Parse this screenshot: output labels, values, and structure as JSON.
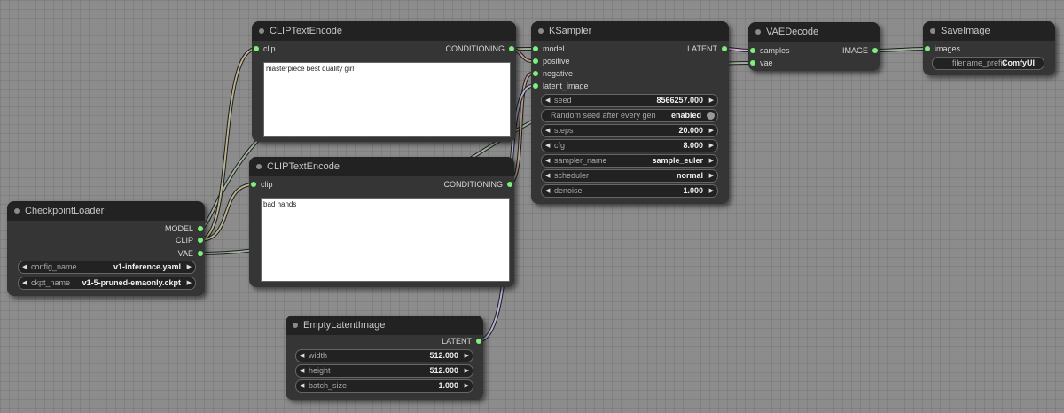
{
  "nodes": {
    "checkpoint_loader": {
      "title": "CheckpointLoader",
      "outputs": [
        "MODEL",
        "CLIP",
        "VAE"
      ],
      "widgets": [
        {
          "label": "config_name",
          "value": "v1-inference.yaml"
        },
        {
          "label": "ckpt_name",
          "value": "v1-5-pruned-emaonly.ckpt"
        }
      ]
    },
    "clip_text_encode_positive": {
      "title": "CLIPTextEncode",
      "input": "clip",
      "output": "CONDITIONING",
      "text": "masterpiece best quality girl"
    },
    "clip_text_encode_negative": {
      "title": "CLIPTextEncode",
      "input": "clip",
      "output": "CONDITIONING",
      "text": "bad hands"
    },
    "ksampler": {
      "title": "KSampler",
      "inputs": [
        "model",
        "positive",
        "negative",
        "latent_image"
      ],
      "output": "LATENT",
      "widgets": [
        {
          "label": "seed",
          "value": "8566257.000"
        },
        {
          "label": "Random seed after every gen",
          "value": "enabled"
        },
        {
          "label": "steps",
          "value": "20.000"
        },
        {
          "label": "cfg",
          "value": "8.000"
        },
        {
          "label": "sampler_name",
          "value": "sample_euler"
        },
        {
          "label": "scheduler",
          "value": "normal"
        },
        {
          "label": "denoise",
          "value": "1.000"
        }
      ]
    },
    "vae_decode": {
      "title": "VAEDecode",
      "inputs": [
        "samples",
        "vae"
      ],
      "output": "IMAGE"
    },
    "save_image": {
      "title": "SaveImage",
      "input": "images",
      "widgets": [
        {
          "label": "filename_prefix",
          "value": "ComfyUI"
        }
      ]
    },
    "empty_latent_image": {
      "title": "EmptyLatentImage",
      "output": "LATENT",
      "widgets": [
        {
          "label": "width",
          "value": "512.000"
        },
        {
          "label": "height",
          "value": "512.000"
        },
        {
          "label": "batch_size",
          "value": "1.000"
        }
      ]
    }
  },
  "colors": {
    "canvas": "#8c8c8c",
    "node_body": "#353535",
    "node_title": "#222222",
    "slot_pin": "#7cf07c",
    "link": "#9fb29f"
  }
}
